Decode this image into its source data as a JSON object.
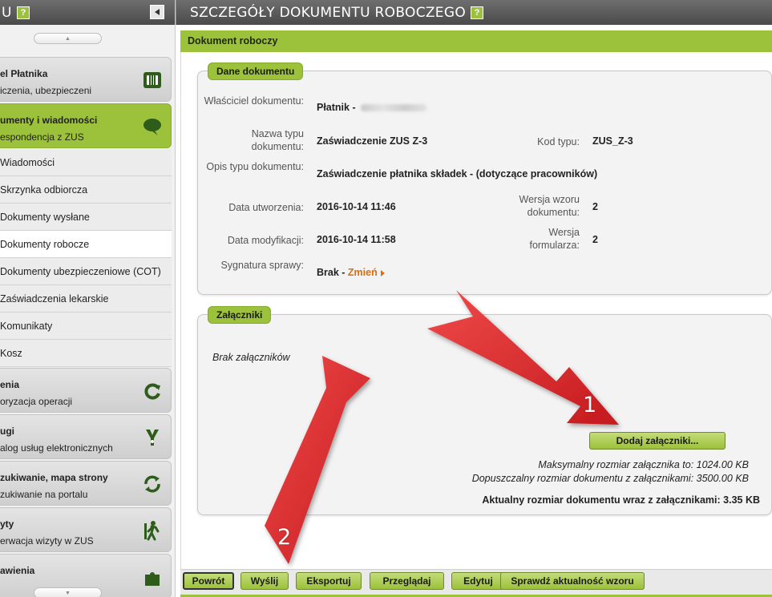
{
  "sidebar": {
    "title": "U",
    "help_label": "?",
    "scroll_up_glyph": "▲",
    "scroll_down_glyph": "▼",
    "groups": [
      {
        "title": "el Płatnika",
        "subtitle": "iczenia, ubezpieczeni",
        "icon": "archive-icon",
        "active": false
      },
      {
        "title": "umenty i wiadomości",
        "subtitle": "espondencja z ZUS",
        "icon": "speech-bubble-icon",
        "active": true
      },
      {
        "title": "enia",
        "subtitle": "oryzacja operacji",
        "icon": "refresh-arrow-icon",
        "active": false
      },
      {
        "title": "ugi",
        "subtitle": "alog usług elektronicznych",
        "icon": "service-tools-icon",
        "active": false
      },
      {
        "title": "zukiwanie, mapa strony",
        "subtitle": "zukiwanie na portalu",
        "icon": "sync-icon",
        "active": false
      },
      {
        "title": "yty",
        "subtitle": "erwacja wizyty w ZUS",
        "icon": "walking-person-icon",
        "active": false
      },
      {
        "title": "awienia",
        "subtitle": "",
        "icon": "puzzle-icon",
        "active": false
      }
    ],
    "items": [
      {
        "label": "Wiadomości",
        "selected": false
      },
      {
        "label": "Skrzynka odbiorcza",
        "selected": false
      },
      {
        "label": "Dokumenty wysłane",
        "selected": false
      },
      {
        "label": "Dokumenty robocze",
        "selected": true
      },
      {
        "label": "Dokumenty ubezpieczeniowe (COT)",
        "selected": false
      },
      {
        "label": "Zaświadczenia lekarskie",
        "selected": false
      },
      {
        "label": "Komunikaty",
        "selected": false
      },
      {
        "label": "Kosz",
        "selected": false
      }
    ]
  },
  "header": {
    "title": "SZCZEGÓŁY DOKUMENTU ROBOCZEGO",
    "help_label": "?"
  },
  "section_title": "Dokument roboczy",
  "document_panel": {
    "tab": "Dane dokumentu",
    "owner_label": "Właściciel dokumentu:",
    "owner_value": "Płatnik -",
    "type_name_label": "Nazwa typu dokumentu:",
    "type_name_value": "Zaświadczenie ZUS Z-3",
    "type_code_label": "Kod typu:",
    "type_code_value": "ZUS_Z-3",
    "type_desc_label": "Opis typu dokumentu:",
    "type_desc_value": "Zaświadczenie płatnika składek - (dotyczące pracowników)",
    "created_label": "Data utworzenia:",
    "created_value": "2016-10-14 11:46",
    "template_version_label": "Wersja wzoru dokumentu:",
    "template_version_value": "2",
    "modified_label": "Data modyfikacji:",
    "modified_value": "2016-10-14 11:58",
    "form_version_label": "Wersja formularza:",
    "form_version_value": "2",
    "case_label": "Sygnatura sprawy:",
    "case_value": "Brak -",
    "case_change_link": "Zmień"
  },
  "attachments_panel": {
    "tab": "Załączniki",
    "empty_text": "Brak załączników",
    "add_button": "Dodaj załączniki...",
    "max_attachment": "Maksymalny rozmiar załącznika to: 1024.00 KB",
    "max_document": "Dopuszczalny rozmiar dokumentu z załącznikami: 3500.00 KB",
    "current_size": "Aktualny rozmiar dokumentu wraz z załącznikami: 3.35 KB"
  },
  "bottom_buttons": {
    "back": "Powrót",
    "send": "Wyślij",
    "export": "Eksportuj",
    "browse": "Przeglądaj",
    "edit": "Edytuj",
    "check": "Sprawdź aktualność wzoru"
  },
  "annotations": {
    "arrow_1": "1",
    "arrow_2": "2",
    "color": "#e0262a"
  },
  "colors": {
    "accent": "#9cc13a",
    "header": "#5a5a5a",
    "link": "#d96d12"
  }
}
